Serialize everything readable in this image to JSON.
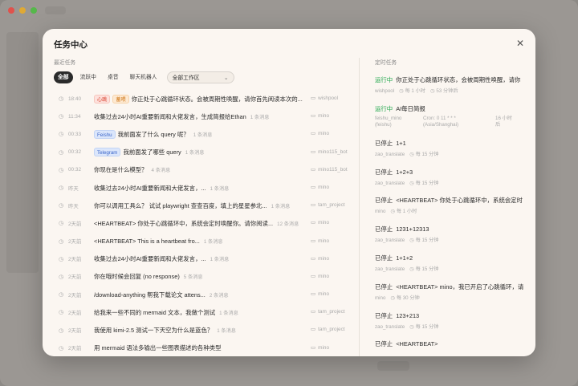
{
  "modal": {
    "title": "任务中心",
    "close": "✕"
  },
  "recent": {
    "label": "最近任务",
    "filters": [
      "全部",
      "流跃中",
      "桌音",
      "聊天机器人"
    ],
    "workspace_select": "全部工作区",
    "rows": [
      {
        "time": "18:40",
        "badges": [
          {
            "text": "心跳",
            "color": "red"
          },
          {
            "text": "蓄喂",
            "color": "orange"
          }
        ],
        "text": "你正处于心跳循环状态。会被周期性唤醒，请你首先阅读本次的...",
        "count": "",
        "folder": "wishpool"
      },
      {
        "time": "11:34",
        "badges": [],
        "text": "收集过去24小时AI重要新闻和大佬发言，生成简报给Ethan",
        "count": "1 条消息",
        "folder": "mino"
      },
      {
        "time": "00:33",
        "badges": [
          {
            "text": "Feishu",
            "color": "blue"
          }
        ],
        "text": "我前面发了什么 query 呢？",
        "count": "1 条消息",
        "folder": "mino"
      },
      {
        "time": "00:32",
        "badges": [
          {
            "text": "Telegram",
            "color": "blue"
          }
        ],
        "text": "我前面发了哪些 query",
        "count": "1 条消息",
        "folder": "mino115_bot"
      },
      {
        "time": "00:32",
        "badges": [],
        "text": "你现在是什么模型？",
        "count": "4 条消息",
        "folder": "mino115_bot"
      },
      {
        "time": "昨天",
        "badges": [],
        "text": "收集过去24小时AI重要新闻和大佬发言，...",
        "count": "1 条消息",
        "folder": "mino"
      },
      {
        "time": "昨天",
        "badges": [],
        "text": "你可以调用工具么？ 试试 playwright 查查百度，填上的星星参北...",
        "count": "1 条消息",
        "folder": "tam_project"
      },
      {
        "time": "2天前",
        "badges": [],
        "text": "<HEARTBEAT> 你处于心跳循环中，系统会定时唤醒你。请你阅读...",
        "count": "12 条消息",
        "folder": "mino"
      },
      {
        "time": "2天前",
        "badges": [],
        "text": "<HEARTBEAT> This is a heartbeat fro...",
        "count": "1 条消息",
        "folder": "mino"
      },
      {
        "time": "2天前",
        "badges": [],
        "text": "收集过去24小时AI重要新闻和大佬发言，...",
        "count": "1 条消息",
        "folder": "mino"
      },
      {
        "time": "2天前",
        "badges": [],
        "text": "你在哦时候会回复 (no response)",
        "count": "5 条消息",
        "folder": "mino"
      },
      {
        "time": "2天前",
        "badges": [],
        "text": "/download-anything 帮我下载论文 attens...",
        "count": "2 条消息",
        "folder": "mino"
      },
      {
        "time": "2天前",
        "badges": [],
        "text": "给我来一些不同的 mermaid 文本，我做个测试",
        "count": "1 条消息",
        "folder": "tam_project"
      },
      {
        "time": "2天前",
        "badges": [],
        "text": "我使用 kimi-2.5 测试一下天空为什么是蓝色？",
        "count": "1 条消息",
        "folder": "tam_project"
      },
      {
        "time": "2天前",
        "badges": [],
        "text": "用 mermaid 语法多输出一些图表描述的各种类型",
        "count": "",
        "folder": "mino"
      }
    ]
  },
  "scheduled": {
    "label": "定时任务",
    "tasks": [
      {
        "status": "运行中",
        "running": true,
        "text": "你正处于心跳循环状态，会被周期性唤醒，请你",
        "meta": [
          "wishpool",
          "每 1 小时",
          "53 分钟后"
        ],
        "multi": false
      },
      {
        "status": "运行中",
        "running": true,
        "text": "AI每日简报",
        "meta_grid": [
          [
            "feishu_mino",
            "(feishu)"
          ],
          [
            "Cron: 0 11 * * *",
            "(Asia/Shanghai)"
          ],
          [
            "16 小时",
            "后"
          ]
        ],
        "multi": true
      },
      {
        "status": "已停止",
        "running": false,
        "text": "1+1",
        "meta": [
          "zao_translate",
          "每 15 分钟"
        ],
        "multi": false
      },
      {
        "status": "已停止",
        "running": false,
        "text": "1+2+3",
        "meta": [
          "zao_translate",
          "每 15 分钟"
        ],
        "multi": false
      },
      {
        "status": "已停止",
        "running": false,
        "text": "<HEARTBEAT> 你处于心跳循环中，系统会定时",
        "meta": [
          "mino",
          "每 1 小时"
        ],
        "multi": false
      },
      {
        "status": "已停止",
        "running": false,
        "text": "1231+12313",
        "meta": [
          "zao_translate",
          "每 15 分钟"
        ],
        "multi": false
      },
      {
        "status": "已停止",
        "running": false,
        "text": "1+1+2",
        "meta": [
          "zao_translate",
          "每 15 分钟"
        ],
        "multi": false
      },
      {
        "status": "已停止",
        "running": false,
        "text": "<HEARTBEAT> mino，我已开启了心跳循环，请",
        "meta": [
          "mino",
          "每 30 分钟"
        ],
        "multi": false
      },
      {
        "status": "已停止",
        "running": false,
        "text": "123+213",
        "meta": [
          "zao_translate",
          "每 15 分钟"
        ],
        "multi": false
      },
      {
        "status": "已停止",
        "running": false,
        "text": "<HEARTBEAT>",
        "meta": [],
        "multi": false
      }
    ]
  }
}
